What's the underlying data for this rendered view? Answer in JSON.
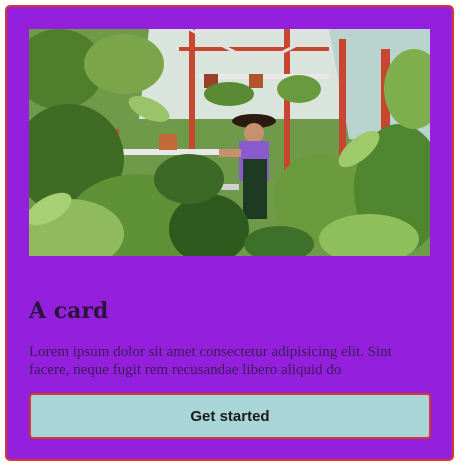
{
  "card": {
    "image_alt": "Person tending plants inside a greenhouse",
    "title": "A card",
    "text": "Lorem ipsum dolor sit amet consectetur adipisicing elit. Sint facere, neque fugit rem recusandae libero aliquid do",
    "button_label": "Get started"
  },
  "colors": {
    "card_background": "#9420de",
    "card_border": "#d23a2e",
    "button_background": "#a9d4d8"
  }
}
